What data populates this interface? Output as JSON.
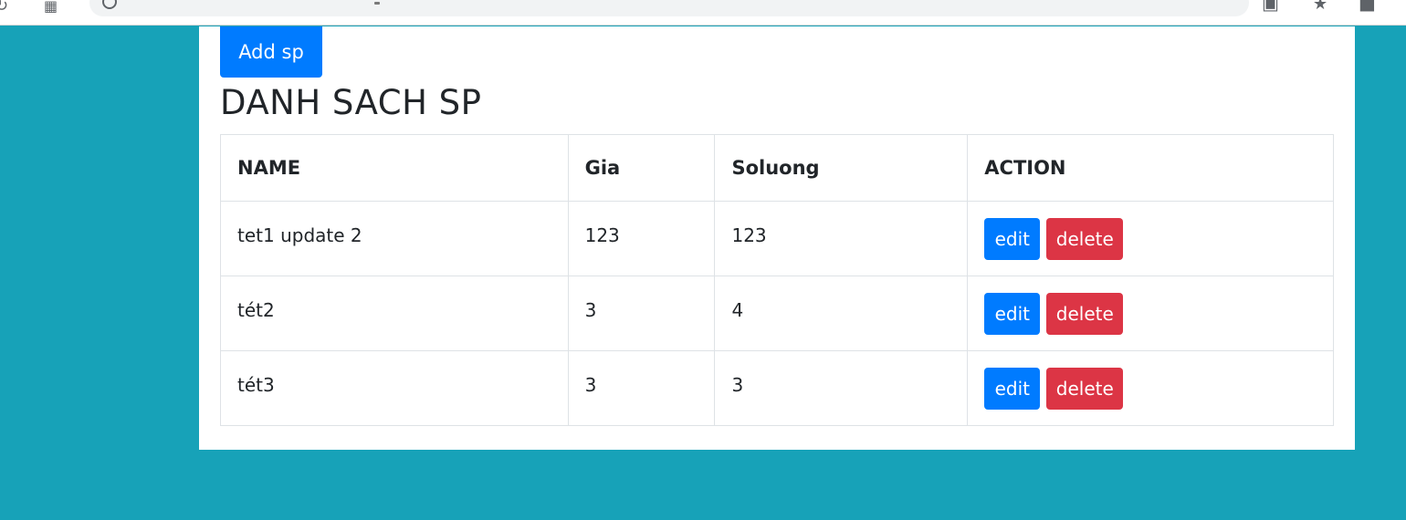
{
  "toolbar": {
    "add_label": "Add sp"
  },
  "page": {
    "title": "DANH SACH SP"
  },
  "table": {
    "headers": {
      "name": "NAME",
      "gia": "Gia",
      "soluong": "Soluong",
      "action": "ACTION"
    },
    "rows": [
      {
        "name": "tet1 update 2",
        "gia": "123",
        "soluong": "123",
        "edit": "edit",
        "delete": "delete"
      },
      {
        "name": "tét2",
        "gia": "3",
        "soluong": "4",
        "edit": "edit",
        "delete": "delete"
      },
      {
        "name": "tét3",
        "gia": "3",
        "soluong": "3",
        "edit": "edit",
        "delete": "delete"
      }
    ]
  },
  "icons": {
    "reload": "reload-icon",
    "apps": "apps-icon",
    "site_info": "site-info-icon",
    "screenshot": "screenshot-icon",
    "bookmark": "star-icon",
    "profile": "profile-icon"
  },
  "colors": {
    "background": "#17a2b8",
    "primary": "#007bff",
    "danger": "#dc3545",
    "text": "#212529",
    "border": "#dee2e6"
  }
}
